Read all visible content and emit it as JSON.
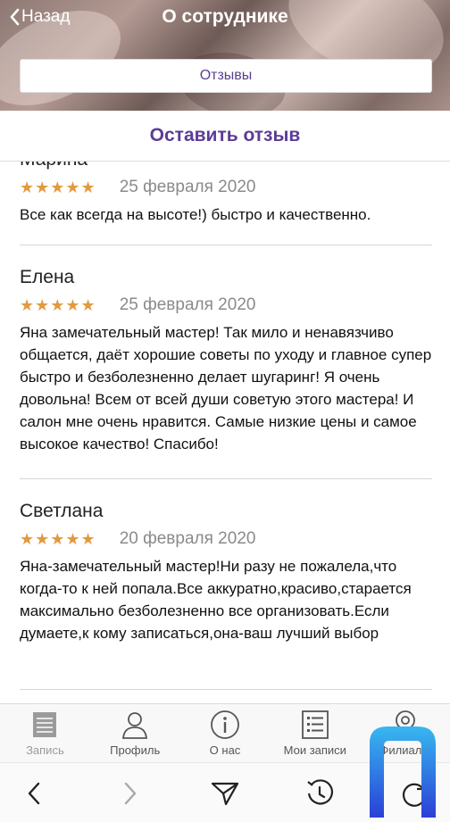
{
  "header": {
    "back_label": "Назад",
    "title": "О сотруднике",
    "reviews_button": "Отзывы"
  },
  "leave_review": "Оставить отзыв",
  "reviews": [
    {
      "name": "Марина",
      "stars": "★★★★★",
      "rating": 5,
      "date": "25 февраля 2020",
      "text": "Все как всегда на высоте!) быстро и качественно."
    },
    {
      "name": "Елена",
      "stars": "★★★★★",
      "rating": 5,
      "date": "25 февраля 2020",
      "text": "Яна замечательный мастер! Так мило и ненавязчиво общается, даёт хорошие советы по уходу и главное супер быстро и безболезненно делает шугаринг! Я очень довольна! Всем от всей души советую этого мастера! И салон мне очень нравится. Самые низкие цены и самое высокое качество! Спасибо!"
    },
    {
      "name": "Светлана",
      "stars": "★★★★★",
      "rating": 5,
      "date": "20 февраля 2020",
      "text": "Яна-замечательный мастер!Ни разу не пожалела,что когда-то к ней попала.Все аккуратно,красиво,старается максимально безболезненно все организовать.Если думаете,к кому записаться,она-ваш лучший выбор"
    }
  ],
  "tabbar": {
    "items": [
      {
        "label": "Запись",
        "icon": "calendar-icon"
      },
      {
        "label": "Профиль",
        "icon": "user-icon"
      },
      {
        "label": "О нас",
        "icon": "info-icon"
      },
      {
        "label": "Мои записи",
        "icon": "list-icon"
      },
      {
        "label": "Филиалы",
        "icon": "location-icon"
      }
    ]
  },
  "colors": {
    "accent": "#5b3c96",
    "star": "#e29a3f",
    "date": "#8a8a8a"
  }
}
